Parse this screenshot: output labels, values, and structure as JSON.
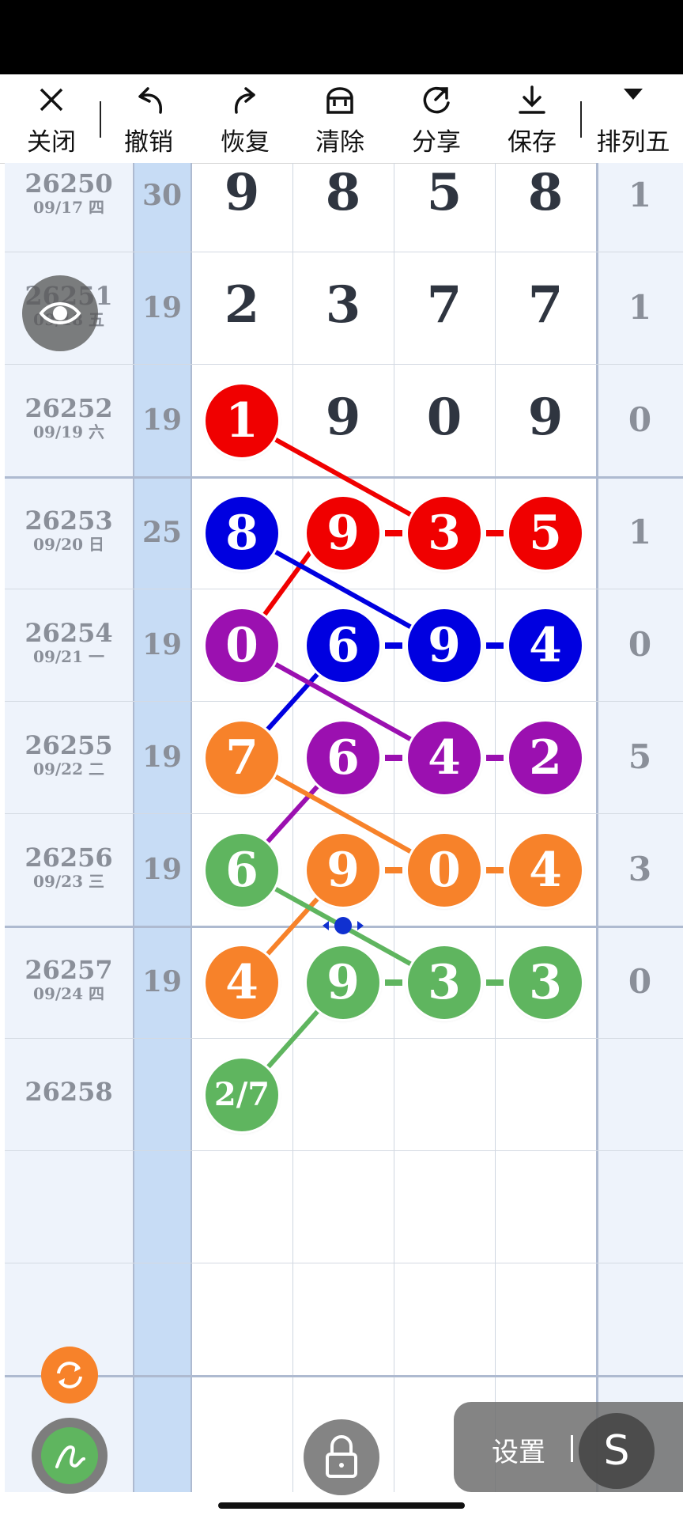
{
  "toolbar": {
    "close": "关闭",
    "undo": "撤销",
    "redo": "恢复",
    "clear": "清除",
    "share": "分享",
    "save": "保存",
    "lottery": "排列五"
  },
  "rows": [
    {
      "issue": "26250",
      "date": "09/17 四",
      "sum": "30",
      "digits": [
        "9",
        "8",
        "5",
        "8"
      ],
      "last": "1"
    },
    {
      "issue": "26251",
      "date": "09/18 五",
      "sum": "19",
      "digits": [
        "2",
        "3",
        "7",
        "7"
      ],
      "last": "1"
    },
    {
      "issue": "26252",
      "date": "09/19 六",
      "sum": "19",
      "digits": [
        "1",
        "9",
        "0",
        "9"
      ],
      "last": "0"
    },
    {
      "issue": "26253",
      "date": "09/20 日",
      "sum": "25",
      "digits": [
        "8",
        "9",
        "3",
        "5"
      ],
      "last": "1"
    },
    {
      "issue": "26254",
      "date": "09/21 一",
      "sum": "19",
      "digits": [
        "0",
        "6",
        "9",
        "4"
      ],
      "last": "0"
    },
    {
      "issue": "26255",
      "date": "09/22 二",
      "sum": "19",
      "digits": [
        "7",
        "6",
        "4",
        "2"
      ],
      "last": "5"
    },
    {
      "issue": "26256",
      "date": "09/23 三",
      "sum": "19",
      "digits": [
        "6",
        "9",
        "0",
        "4"
      ],
      "last": "3"
    },
    {
      "issue": "26257",
      "date": "09/24 四",
      "sum": "19",
      "digits": [
        "4",
        "9",
        "3",
        "3"
      ],
      "last": "0"
    },
    {
      "issue": "26258",
      "date": "",
      "sum": "",
      "digits": [
        "2/7",
        "",
        "",
        ""
      ],
      "last": ""
    }
  ],
  "colors": {
    "red": "#f00000",
    "blue": "#0000e0",
    "purple": "#9b10b0",
    "orange": "#f7822a",
    "green": "#5fb55f"
  },
  "bottom": {
    "settings": "设置",
    "s_button": "S"
  }
}
